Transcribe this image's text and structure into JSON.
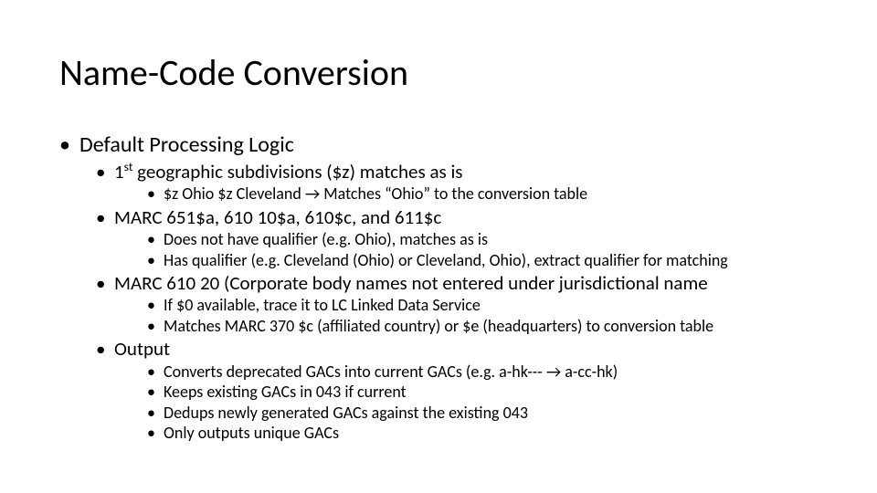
{
  "title": "Name-Code Conversion",
  "l1": {
    "item1": "Default Processing Logic"
  },
  "l2": {
    "item1_pre": "1",
    "item1_sup": "st",
    "item1_post": " geographic subdivisions ($z) matches as is",
    "item2": "MARC 651$a, 610 10$a, 610$c, and 611$c",
    "item3": "MARC 610 20 (Corporate body names not entered under jurisdictional name",
    "item4": "Output"
  },
  "l3": {
    "a1": "$z Ohio $z Cleveland → Matches “Ohio” to the conversion table",
    "b1": "Does not have qualifier (e.g. Ohio), matches as is",
    "b2": "Has qualifier (e.g. Cleveland (Ohio) or Cleveland, Ohio), extract qualifier for matching",
    "c1": "If $0 available, trace it to LC Linked Data Service",
    "c2": "Matches MARC 370 $c (affiliated country) or $e (headquarters) to conversion table",
    "d1": "Converts deprecated GACs into current GACs (e.g. a-hk--- → a-cc-hk)",
    "d2": "Keeps existing GACs in 043 if current",
    "d3": "Dedups newly generated GACs against the existing 043",
    "d4": "Only outputs unique GACs"
  }
}
